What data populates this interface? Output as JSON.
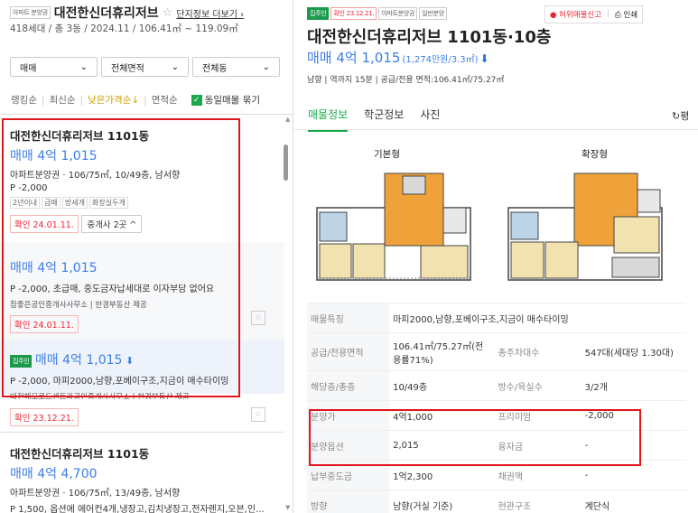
{
  "left": {
    "header": {
      "type_tag": "아파트 분양권",
      "complex_name": "대전한신더휴리저브",
      "more_link": "단지정보 더보기",
      "summary": "418세대 / 총 3동 / 2024.11 / 106.41㎡ ~ 119.09㎡"
    },
    "filters": {
      "trade": "매매",
      "area": "전체면적",
      "dong": "전체동"
    },
    "sort": {
      "opt1": "랭킹순",
      "opt2": "최신순",
      "opt3": "낮은가격순↓",
      "opt4": "면적순",
      "same_label": "동일매물 묶기"
    },
    "listing1": {
      "title": "대전한신더휴리저브 1101동",
      "price": "매매 4억 1,015",
      "desc": "아파트분양권 · 106/75㎡, 10/49층, 남서향",
      "premium": "P -2,000",
      "chips": [
        "2년이내",
        "급매",
        "방세개",
        "화장실두개"
      ],
      "confirm": "확인 24.01.11.",
      "broker": "중개사 2곳"
    },
    "listing1a": {
      "price": "매매 4억 1,015",
      "desc": "P -2,000, 초급매, 중도금자납세대로 이자부담 없어요",
      "agent": "참좋은공인중개사사무소 | 한경부동산 제공",
      "confirm": "확인 24.01.11."
    },
    "listing1b": {
      "tag": "집주인",
      "price": "매매 4억 1,015",
      "desc": "P -2,000, 마피2000,남향,포베이구조,지금이 매수타이밍",
      "agent": "대전해모로드센트라공인중개사사무소 | 한경부동산 제공",
      "confirm": "확인 23.12.21."
    },
    "listing2": {
      "title": "대전한신더휴리저브 1101동",
      "price": "매매 4억 4,700",
      "desc": "아파트분양권 · 106/75㎡, 13/49층, 남서향",
      "premium": "P 1,500, 옵션에 에어컨4개,냉장고,김치냉장고,전자렌지,오븐,인..."
    }
  },
  "right": {
    "tags": {
      "owner": "집주인",
      "confirm": "확인 23.12.21.",
      "type": "아파트분양권",
      "sale": "일반분양"
    },
    "report": "허위매물신고",
    "print": "인쇄",
    "title": "대전한신더휴리저브 1101동·10층",
    "price_main": "매매 4억 1,015",
    "price_sub": "(1,274만원/3.3㎡)",
    "meta": "남향 | 역까지 15분 | 공급/전용 면적:106.41㎡/75.27㎡",
    "tabs": [
      "매물정보",
      "학군정보",
      "사진"
    ],
    "refresh": "평",
    "plan_basic": "기본형",
    "plan_ext": "확장형",
    "rows": [
      {
        "k": "매물특징",
        "v": "마피2000,남향,포베이구조,지금이 매수타이밍",
        "k2": "",
        "v2": ""
      },
      {
        "k": "공급/전용면적",
        "v": "106.41㎡/75.27㎡(전용률71%)",
        "k2": "총주차대수",
        "v2": "547대(세대당 1.30대)"
      },
      {
        "k": "해당층/총층",
        "v": "10/49층",
        "k2": "방수/욕실수",
        "v2": "3/2개"
      },
      {
        "k": "분양가",
        "v": "4억1,000",
        "k2": "프리미엄",
        "v2": "-2,000"
      },
      {
        "k": "분양옵션",
        "v": "2,015",
        "k2": "융자금",
        "v2": "-"
      },
      {
        "k": "납부중도금",
        "v": "1억2,300",
        "k2": "채권액",
        "v2": "-"
      },
      {
        "k": "방향",
        "v": "남향(거실 기준)",
        "k2": "현관구조",
        "v2": "계단식"
      }
    ]
  }
}
